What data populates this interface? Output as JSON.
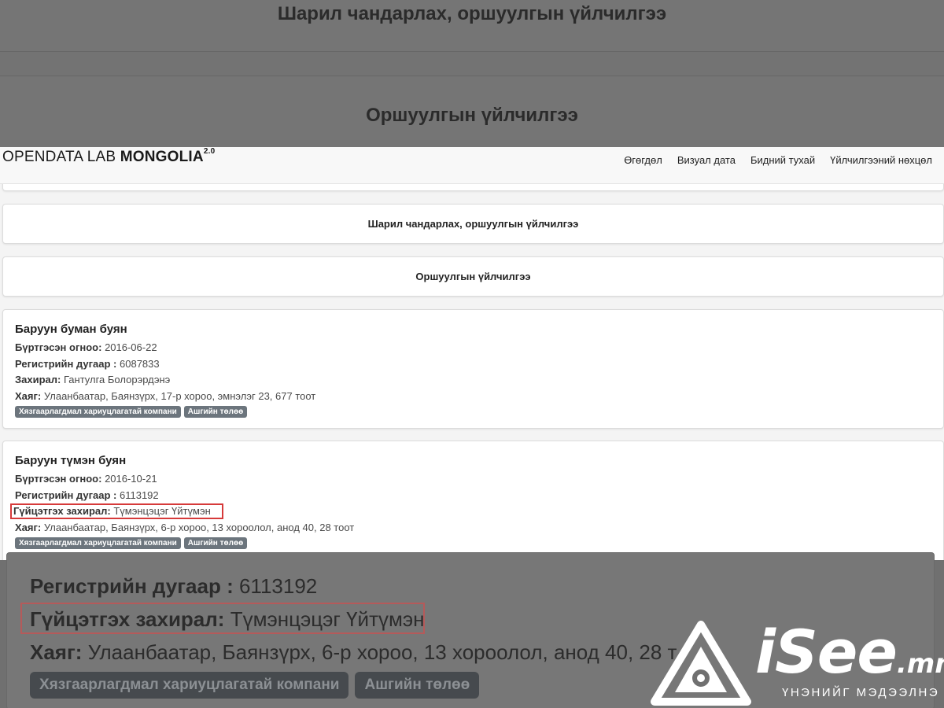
{
  "background": {
    "top_title": "Шарил чандарлах, оршуулгын үйлчилгээ",
    "sub_title": "Оршуулгын үйлчилгээ",
    "zoom": {
      "registry_label": "Регистрийн дугаар :",
      "registry_value": "6113192",
      "director_label": "Гүйцэтгэх захирал:",
      "director_value": "Түмэнцэцэг Үйтүмэн",
      "address_label": "Хаяг:",
      "address_value": "Улаанбаатар, Баянзүрх, 6-р хороо, 13 хороолол, анод 40, 28 т",
      "badges": [
        "Хязгаарлагдмал хариуцлагатай компани",
        "Ашгийн төлөө"
      ]
    }
  },
  "navbar": {
    "brand_light": "OPENDATA LAB ",
    "brand_bold": "MONGOLIA",
    "brand_version": "2.0",
    "links": [
      "Өгөгдөл",
      "Визуал дата",
      "Бидний тухай",
      "Үйлчилгээний нөхцөл"
    ]
  },
  "panels": {
    "category": "Шарил чандарлах, оршуулгын үйлчилгээ",
    "subcategory": "Оршуулгын үйлчилгээ"
  },
  "companies": [
    {
      "name": "Баруун буман буян",
      "date_label": "Бүртгэсэн огноо:",
      "date": "2016-06-22",
      "reg_label": "Регистрийн дугаар :",
      "reg": "6087833",
      "dir_label": "Захирал:",
      "director": "Гантулга Болорэрдэнэ",
      "addr_label": "Хаяг:",
      "address": "Улаанбаатар, Баянзүрх, 17-р хороо, эмнэлэг 23, 677 тоот",
      "badges": [
        "Хязгаарлагдмал хариуцлагатай компани",
        "Ашгийн төлөө"
      ]
    },
    {
      "name": "Баруун түмэн буян",
      "date_label": "Бүртгэсэн огноо:",
      "date": "2016-10-21",
      "reg_label": "Регистрийн дугаар :",
      "reg": "6113192",
      "dir_label": "Гүйцэтгэх захирал:",
      "director": "Түмэнцэцэг Үйтүмэн",
      "addr_label": "Хаяг:",
      "address": "Улаанбаатар, Баянзүрх, 6-р хороо, 13 хороолол, анод 40, 28 тоот",
      "badges": [
        "Хязгаарлагдмал хариуцлагатай компани",
        "Ашгийн төлөө"
      ]
    }
  ],
  "watermark": {
    "logo_text": "iSee",
    "logo_domain": ".mn",
    "tagline": "ҮНЭНИЙГ МЭДЭЭЛНЭ",
    "icon": "isee-logo-icon"
  },
  "colors": {
    "highlight_red": "#d63a3a",
    "badge_gray": "#6c757d",
    "overlay_gray": "#737373"
  }
}
